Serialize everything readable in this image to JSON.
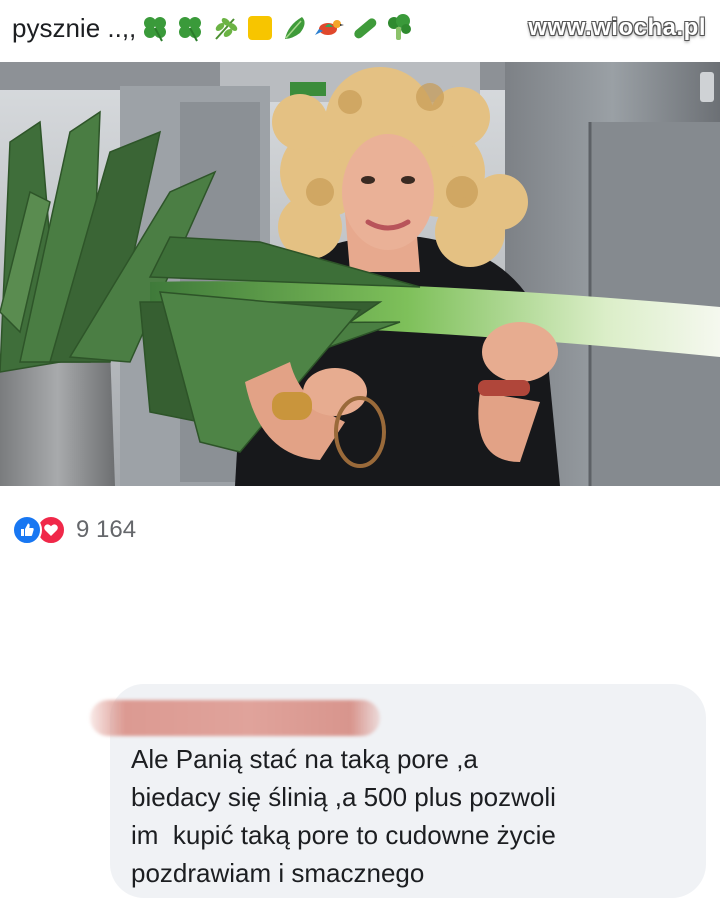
{
  "post": {
    "text": "pysznie ..,,",
    "emojis": [
      "shamrock",
      "shamrock",
      "herb",
      "yellow-square",
      "leafy-green",
      "bird",
      "cucumber",
      "broccoli"
    ]
  },
  "watermark": "www.wiocha.pl",
  "reactions": {
    "count": "9 164",
    "icons": [
      "thumbs-up-icon",
      "heart-icon"
    ]
  },
  "comment": {
    "lines": [
      "Ale Panią stać na taką pore ,a",
      "biedacy się ślinią ,a 500 plus pozwoli",
      "im  kupić taką pore to cudowne życie",
      "pozdrawiam i smacznego"
    ]
  },
  "colors": {
    "like_blue": "#1877f2",
    "love_red": "#f02849",
    "bubble_bg": "#f0f2f5",
    "count_gray": "#65676b"
  }
}
